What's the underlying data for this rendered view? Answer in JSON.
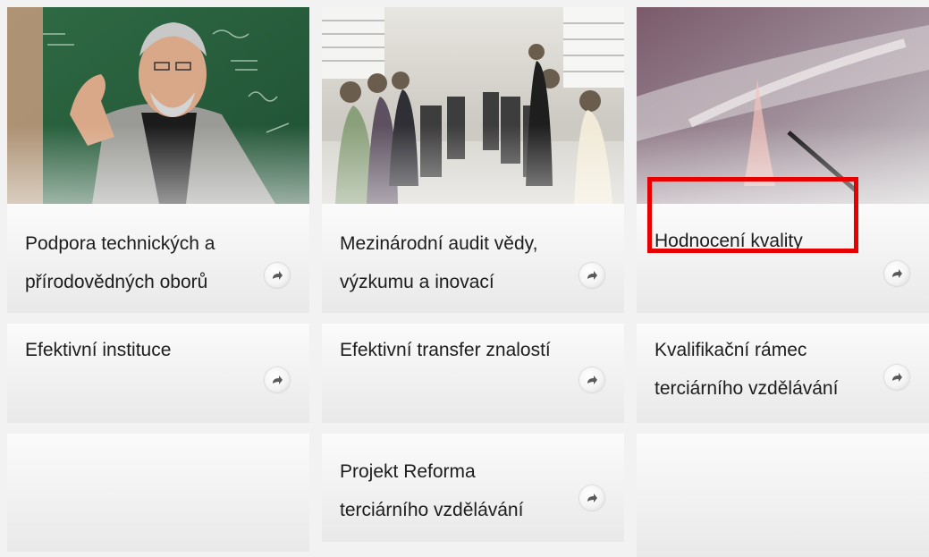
{
  "tiles": {
    "c1r1": "Podpora technických a přírodovědných oborů",
    "c2r1": "Mezinárodní audit vědy, výzkumu a inovací",
    "c3r1": "Hodnocení kvality",
    "c1r2": "Efektivní instituce",
    "c2r2": "Efektivní transfer znalostí",
    "c3r2": "Kvalifikační rámec terciárního vzdělávání",
    "c2r3": "Projekt Reforma terciárního vzdělávání"
  },
  "photos": {
    "c1": "teacher-at-chalkboard-photo",
    "c2": "computer-classroom-photo",
    "c3": "laboratory-glassware-photo"
  },
  "icons": {
    "tile_arrow": "arrow-right-icon"
  },
  "colors": {
    "highlight": "#e60000",
    "tile_bg": "#efefef",
    "text": "#1d1d1d"
  }
}
